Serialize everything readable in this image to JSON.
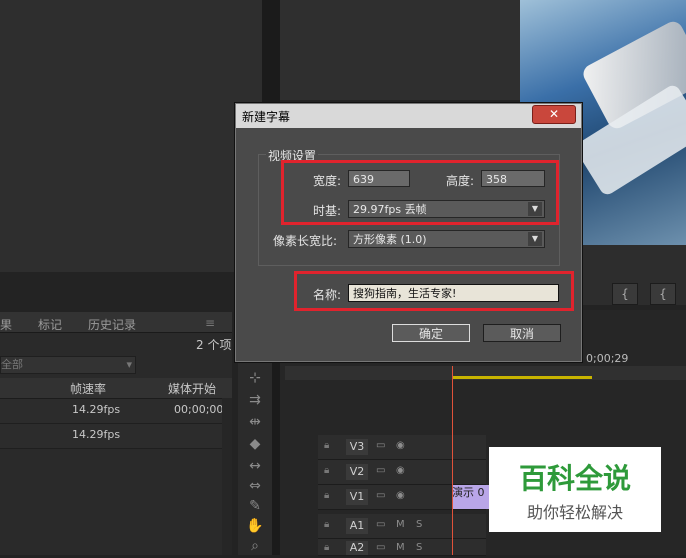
{
  "project_panel": {
    "tabs": [
      "果",
      "标记",
      "历史记录"
    ],
    "item_count": "2 个项",
    "filter_value": "全部",
    "columns": [
      "帧速率",
      "媒体开始"
    ],
    "rows": [
      {
        "fps": "14.29fps",
        "start": "00;00;00"
      },
      {
        "fps": "14.29fps",
        "start": ""
      }
    ]
  },
  "timeline": {
    "timecode": "0;00;29",
    "tracks": [
      "V3",
      "V2",
      "V1",
      "A1",
      "A2"
    ],
    "clip_label": "演示 0"
  },
  "dialog": {
    "title": "新建字幕",
    "close_label": "✕",
    "group_label": "视频设置",
    "width_label": "宽度:",
    "width_value": "639",
    "height_label": "高度:",
    "height_value": "358",
    "timebase_label": "时基:",
    "timebase_value": "29.97fps 丢帧",
    "par_label": "像素长宽比:",
    "par_value": "方形像素 (1.0)",
    "name_label": "名称:",
    "name_value": "搜狗指南，生活专家!",
    "ok_label": "确定",
    "cancel_label": "取消"
  },
  "watermark": {
    "title": "百科全说",
    "subtitle": "助你轻松解决"
  },
  "colors": {
    "highlight": "#e0232d",
    "watermark_green": "#2e9a3a",
    "clip_purple": "#b9a6e8",
    "playhead": "#e0523a"
  }
}
